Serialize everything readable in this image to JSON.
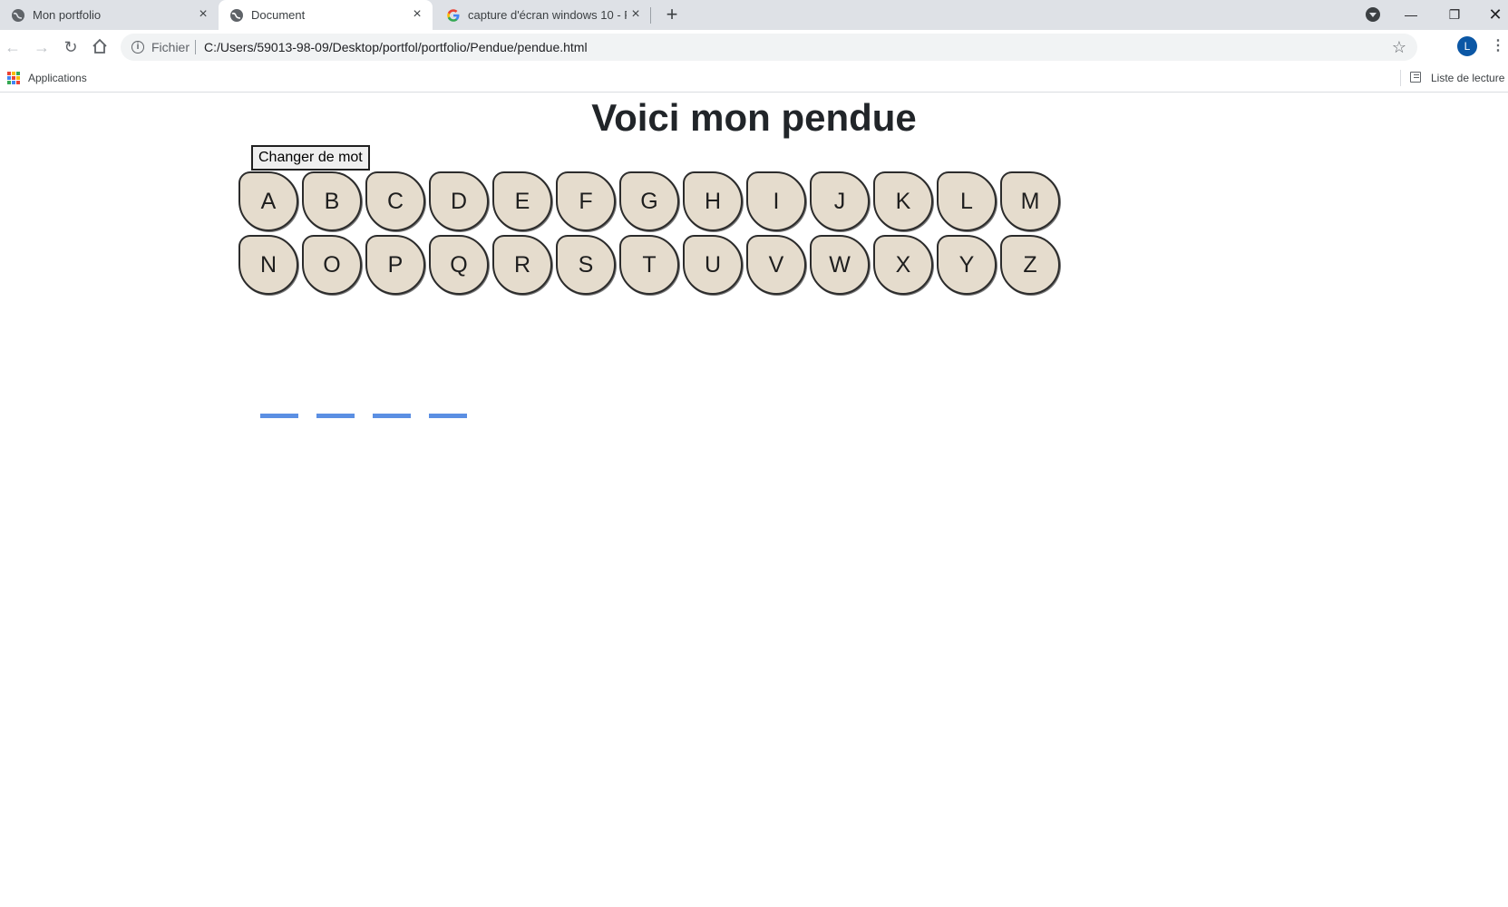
{
  "browser": {
    "tabs": [
      {
        "title": "Mon portfolio",
        "active": false,
        "favicon": "globe-icon"
      },
      {
        "title": "Document",
        "active": true,
        "favicon": "globe-icon"
      },
      {
        "title": "capture d'écran windows 10 - Re",
        "active": false,
        "favicon": "google-icon"
      }
    ],
    "omnibox": {
      "scheme_label": "Fichier",
      "url": "C:/Users/59013-98-09/Desktop/portfol/portfolio/Pendue/pendue.html"
    },
    "profile_initial": "L",
    "bookmarks": {
      "apps_label": "Applications",
      "reading_list_label": "Liste de lecture"
    }
  },
  "page": {
    "title": "Voici mon pendue",
    "change_word_label": "Changer de mot",
    "keyboard_rows": [
      [
        "A",
        "B",
        "C",
        "D",
        "E",
        "F",
        "G",
        "H",
        "I",
        "J",
        "K",
        "L",
        "M"
      ],
      [
        "N",
        "O",
        "P",
        "Q",
        "R",
        "S",
        "T",
        "U",
        "V",
        "W",
        "X",
        "Y",
        "Z"
      ]
    ],
    "word_length": 4,
    "colors": {
      "key_background": "#e5dccd",
      "blank_underline": "#5b8fe3"
    }
  }
}
